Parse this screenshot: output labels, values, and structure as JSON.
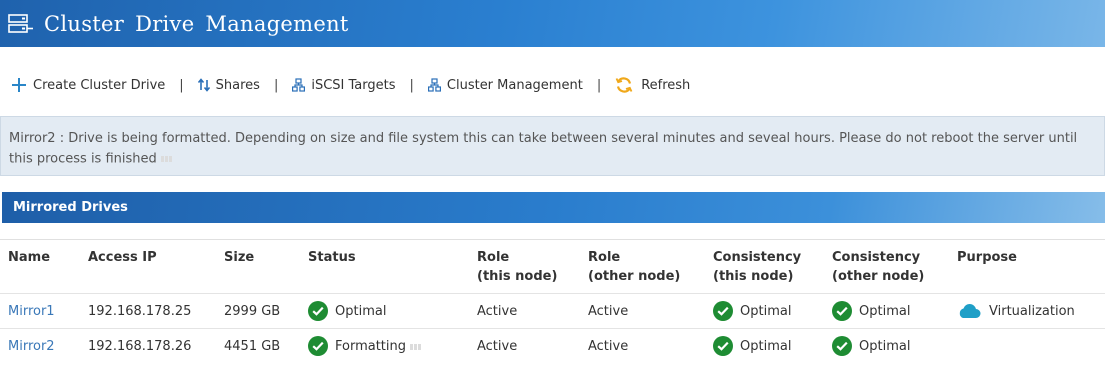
{
  "header": {
    "title": "Cluster Drive Management",
    "icon": "server-icon"
  },
  "toolbar": {
    "create_label": "Create Cluster Drive",
    "shares_label": "Shares",
    "iscsi_label": "iSCSI Targets",
    "cluster_label": "Cluster Management",
    "refresh_label": "Refresh",
    "separator": "|"
  },
  "notice": {
    "text": "Mirror2 : Drive is being formatted. Depending on size and file system this can take between several minutes and seveal hours. Please do not reboot the server until this process is finished"
  },
  "section": {
    "title": "Mirrored Drives"
  },
  "table": {
    "headers": {
      "name": "Name",
      "access_ip": "Access IP",
      "size": "Size",
      "status": "Status",
      "role_this_1": "Role",
      "role_this_2": "(this node)",
      "role_other_1": "Role",
      "role_other_2": "(other node)",
      "cons_this_1": "Consistency",
      "cons_this_2": "(this node)",
      "cons_other_1": "Consistency",
      "cons_other_2": "(other node)",
      "purpose": "Purpose"
    },
    "rows": [
      {
        "name": "Mirror1",
        "ip": "192.168.178.25",
        "size": "2999 GB",
        "status": "Optimal",
        "role_this": "Active",
        "role_other": "Active",
        "cons_this": "Optimal",
        "cons_other": "Optimal",
        "purpose": "Virtualization"
      },
      {
        "name": "Mirror2",
        "ip": "192.168.178.26",
        "size": "4451 GB",
        "status": "Formatting",
        "role_this": "Active",
        "role_other": "Active",
        "cons_this": "Optimal",
        "cons_other": "Optimal",
        "purpose": ""
      }
    ]
  },
  "colors": {
    "accent": "#2a7fd0",
    "ok": "#1e8c33",
    "link": "#3a78b8",
    "refresh": "#f0a81a",
    "cloud": "#1f9fc7"
  }
}
